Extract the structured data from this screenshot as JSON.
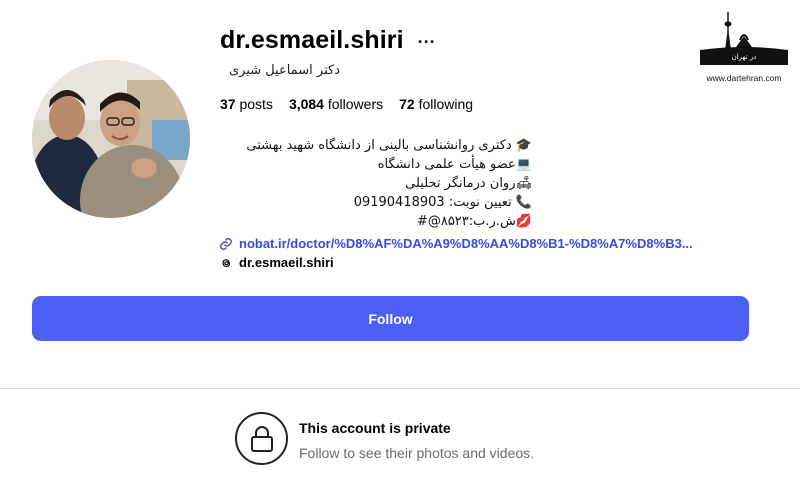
{
  "profile": {
    "username": "dr.esmaeil.shiri",
    "more_label": "...",
    "full_name": "دکتر اسماعیل شیری",
    "stats": {
      "posts_count": "37",
      "posts_label": "posts",
      "followers_count": "3,084",
      "followers_label": "followers",
      "following_count": "72",
      "following_label": "following"
    },
    "bio_lines": [
      "🎓 دکتری روانشناسی بالینی از دانشگاه شهید بهشتی",
      "💻عضو هیأت علمی دانشگاه",
      "🛋روان درمانگر تحلیلی",
      "📞 تعیین نوبت: 09190418903",
      "💋ش.ر.ب:۸۵۲۳@#"
    ],
    "link": "nobat.ir/doctor/%D8%AF%DA%A9%D8%AA%D8%B1-%D8%A7%D8%B3...",
    "threads_handle": "dr.esmaeil.shiri"
  },
  "follow_button_label": "Follow",
  "private": {
    "title": "This account is private",
    "subtitle": "Follow to see their photos and videos."
  },
  "watermark": {
    "text": "در تهران",
    "url": "www.dartehran.com"
  },
  "colors": {
    "accent": "#4d60f5",
    "link": "#3a4bd6",
    "muted": "#6b6b6b"
  },
  "icons": [
    "more-icon",
    "link-icon",
    "threads-icon",
    "lock-icon",
    "tehran-tower-icon"
  ]
}
